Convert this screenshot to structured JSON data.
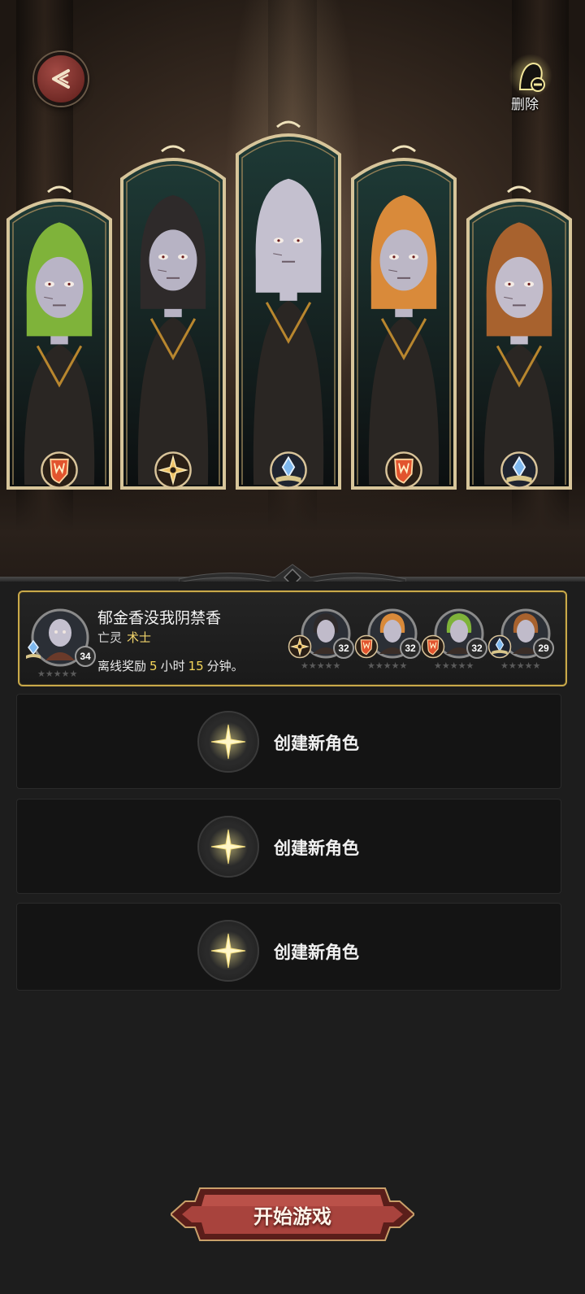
{
  "header": {
    "back_icon": "back-arrow-icon",
    "delete_label": "删除",
    "delete_icon": "remove-character-icon"
  },
  "roster": [
    {
      "id": "green-haired-woman",
      "class_icon": "warrior-shield-icon",
      "skin": "#b9b4c6",
      "hair": "#7fb33a"
    },
    {
      "id": "dark-haired-woman",
      "class_icon": "rogue-compass-icon",
      "skin": "#b7b3c4",
      "hair": "#2e2a2a"
    },
    {
      "id": "bald-man",
      "class_icon": "mage-book-icon",
      "skin": "#c4c0cf",
      "hair": "#c4c0cf"
    },
    {
      "id": "orange-haired-man",
      "class_icon": "warrior-shield-icon",
      "skin": "#bcb7c6",
      "hair": "#d98a3a"
    },
    {
      "id": "braided-woman",
      "class_icon": "mage-book-icon",
      "skin": "#c2bccb",
      "hair": "#a8622e"
    }
  ],
  "active_character": {
    "name": "郁金香没我阴禁香",
    "race": "亡灵",
    "class": "术士",
    "level": "34",
    "offline_prefix": "离线奖励",
    "offline_hours": "5",
    "hours_unit": "小时",
    "offline_minutes": "15",
    "minutes_unit": "分钟。",
    "party": [
      {
        "level": "32",
        "class_icon": "rogue-compass-icon",
        "hair": "#2e2a2a"
      },
      {
        "level": "32",
        "class_icon": "warrior-shield-icon",
        "hair": "#d98a3a"
      },
      {
        "level": "32",
        "class_icon": "warrior-shield-icon",
        "hair": "#7fb33a"
      },
      {
        "level": "29",
        "class_icon": "mage-book-icon",
        "hair": "#a8622e"
      }
    ]
  },
  "empty_slots": [
    {
      "label": "创建新角色"
    },
    {
      "label": "创建新角色"
    },
    {
      "label": "创建新角色"
    }
  ],
  "start_button": {
    "label": "开始游戏"
  },
  "colors": {
    "accent_gold": "#c9a94a",
    "start_red": "#a8433d",
    "level_number": "#f5d65a"
  }
}
